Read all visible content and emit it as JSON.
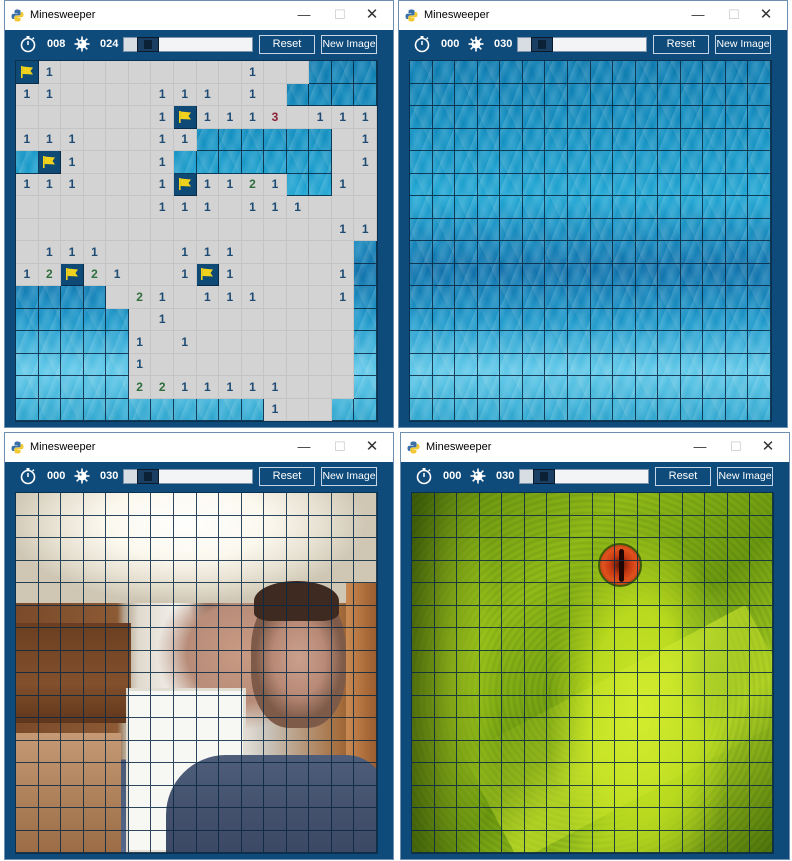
{
  "colors": {
    "window_bg": "#0e4a7a",
    "open_cell": "#d3d3d3",
    "number_1": "#1d4b73",
    "number_2": "#2f6e3c",
    "number_3": "#8a2036",
    "flag": "#f0d21c"
  },
  "windows": [
    {
      "title": "Minesweeper",
      "timer": "008",
      "mines": "024",
      "slider_value": 0.1,
      "reset_label": "Reset",
      "new_image_label": "New Image",
      "background": "ocean",
      "board": [
        "F1........1.....",
        "11....111.1.....",
        "......1F1113.111",
        "111...11.......1",
        ".F1...11.......1",
        "111...1F1121.21.",
        "......111.111...",
        "..............11",
        ".111...111.....1",
        "12F21..1F1....12",
        ".....21.111...1.",
        "......1........1",
        ".....1.1.......1",
        ".....1.........1",
        ".....2211111...2",
        "...........1...1"
      ],
      "open_mask": [
        "1111111111111000",
        "1111111111110000",
        "1111111111111111",
        "1111111100000011",
        "0111111000000011",
        "1111111111110011",
        "1111111111111111",
        "1111111111111111",
        "1111111111111110",
        "1111111111111110",
        "0000111111111110",
        "0000011111111110",
        "0000011111111110",
        "0000011111111110",
        "0000011111111110",
        "0000000000011100"
      ]
    },
    {
      "title": "Minesweeper",
      "timer": "000",
      "mines": "030",
      "slider_value": 0.1,
      "reset_label": "Reset",
      "new_image_label": "New Image",
      "background": "ocean"
    },
    {
      "title": "Minesweeper",
      "timer": "000",
      "mines": "030",
      "slider_value": 0.1,
      "reset_label": "Reset",
      "new_image_label": "New Image",
      "background": "webcam"
    },
    {
      "title": "Minesweeper",
      "timer": "000",
      "mines": "030",
      "slider_value": 0.1,
      "reset_label": "Reset",
      "new_image_label": "New Image",
      "background": "snake"
    }
  ]
}
